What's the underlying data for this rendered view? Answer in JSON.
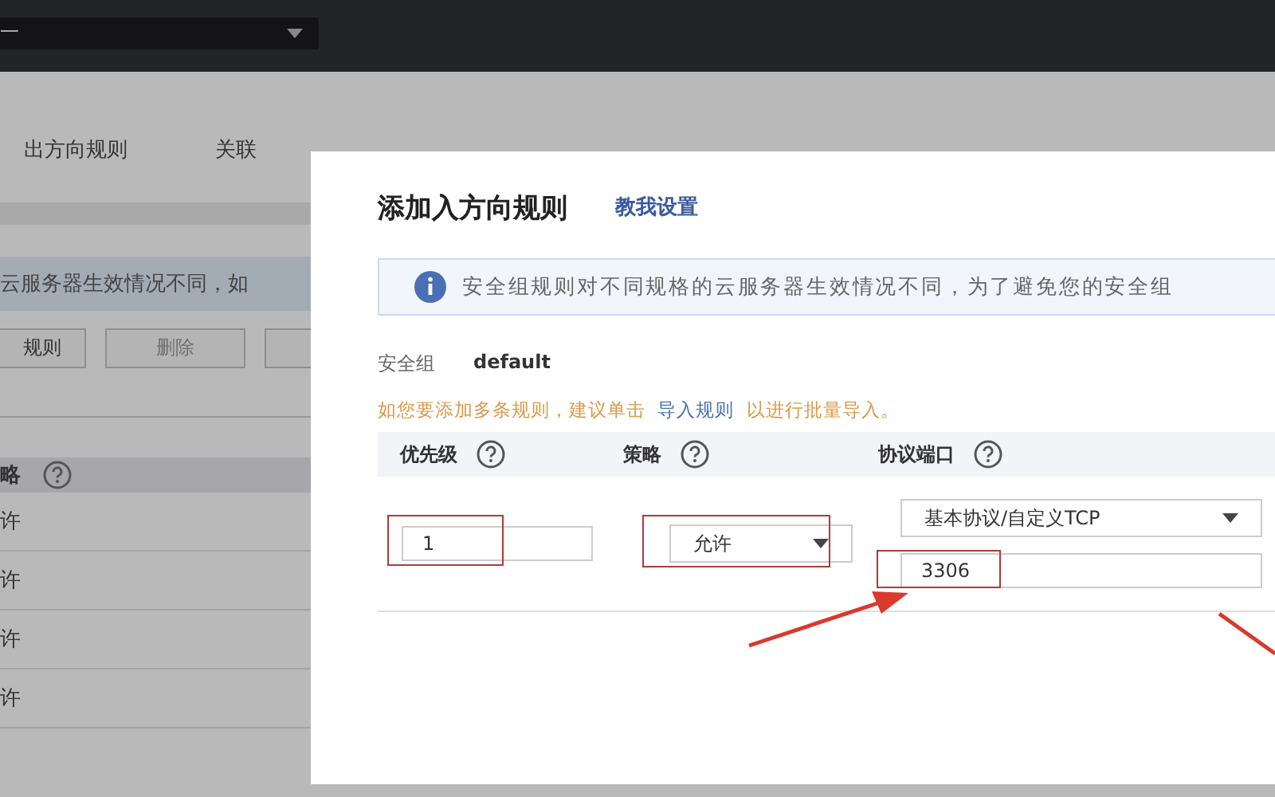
{
  "top_bar": {
    "region_select": {
      "value": "一"
    }
  },
  "page": {
    "tabs": [
      {
        "label": "出方向规则",
        "selected": false
      },
      {
        "label": "关联",
        "selected": false
      }
    ],
    "notice": "云服务器生效情况不同，如",
    "buttons": [
      {
        "label": "规则",
        "disabled": false
      },
      {
        "label": "删除",
        "disabled": true
      },
      {
        "disabled": false
      }
    ],
    "table": {
      "header": "略",
      "rows": [
        "许",
        "许",
        "许",
        "许"
      ]
    }
  },
  "dialog": {
    "title": "添加入方向规则",
    "help_link": "教我设置",
    "info": "安全组规则对不同规格的云服务器生效情况不同，为了避免您的安全组",
    "security_group": {
      "label": "安全组",
      "value": "default"
    },
    "tip": {
      "before": "如您要添加多条规则，建议单击",
      "link": "导入规则",
      "after": "以进行批量导入。"
    },
    "columns": [
      "优先级",
      "策略",
      "协议端口"
    ],
    "rule": {
      "priority": "1",
      "action": "允许",
      "protocol": "基本协议/自定义TCP",
      "port": "3306"
    }
  }
}
